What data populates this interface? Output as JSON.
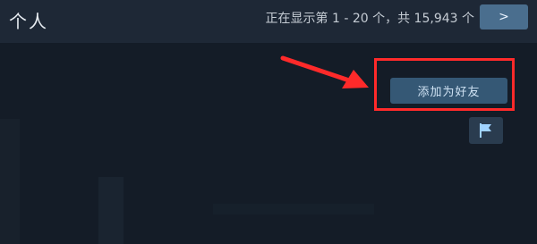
{
  "header": {
    "title": "个人",
    "page_info": "正在显示第 1 - 20 个，共 15,943 个",
    "next_label": ">"
  },
  "profile": {
    "add_friend_label": "添加为好友"
  },
  "icons": {
    "flag": "flag-icon",
    "annotation_arrow": "arrow-icon"
  },
  "colors": {
    "header_bg": "#1e2836",
    "content_bg": "#141c27",
    "button_bg": "#355875",
    "highlight": "#ff2a2a"
  }
}
